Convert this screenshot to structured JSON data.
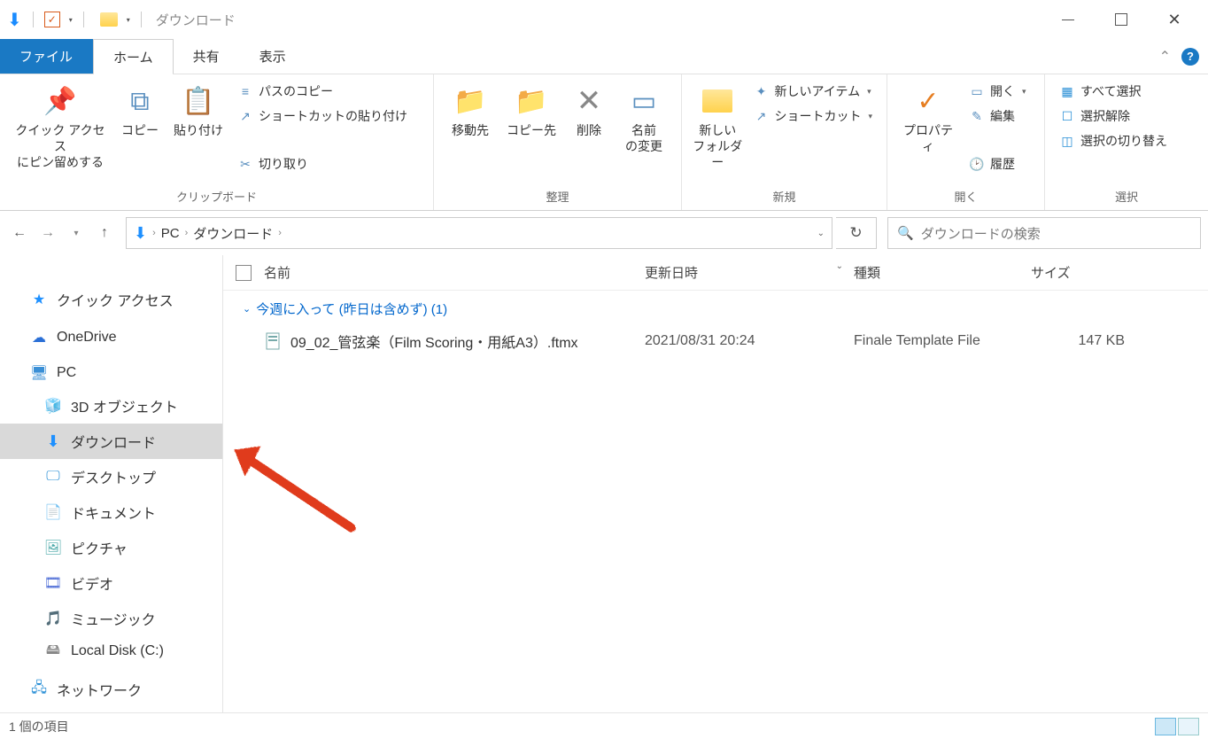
{
  "titlebar": {
    "title": "ダウンロード"
  },
  "tabs": {
    "file": "ファイル",
    "home": "ホーム",
    "share": "共有",
    "view": "表示"
  },
  "ribbon": {
    "pin": "クイック アクセス\nにピン留めする",
    "copy": "コピー",
    "paste": "貼り付け",
    "copy_path": "パスのコピー",
    "paste_shortcut": "ショートカットの貼り付け",
    "cut": "切り取り",
    "group_clipboard": "クリップボード",
    "move_to": "移動先",
    "copy_to": "コピー先",
    "delete": "削除",
    "rename": "名前\nの変更",
    "group_organize": "整理",
    "new_folder": "新しい\nフォルダー",
    "new_item": "新しいアイテム",
    "shortcut": "ショートカット",
    "group_new": "新規",
    "properties": "プロパティ",
    "open": "開く",
    "edit": "編集",
    "history": "履歴",
    "group_open": "開く",
    "select_all": "すべて選択",
    "select_none": "選択解除",
    "invert_sel": "選択の切り替え",
    "group_select": "選択"
  },
  "breadcrumb": {
    "pc": "PC",
    "downloads": "ダウンロード"
  },
  "search": {
    "placeholder": "ダウンロードの検索"
  },
  "columns": {
    "name": "名前",
    "date": "更新日時",
    "type": "種類",
    "size": "サイズ"
  },
  "nav": {
    "quick_access": "クイック アクセス",
    "onedrive": "OneDrive",
    "pc": "PC",
    "objects3d": "3D オブジェクト",
    "downloads": "ダウンロード",
    "desktop": "デスクトップ",
    "documents": "ドキュメント",
    "pictures": "ピクチャ",
    "videos": "ビデオ",
    "music": "ミュージック",
    "localdisk": "Local Disk (C:)",
    "network": "ネットワーク"
  },
  "group_label": "今週に入って (昨日は含めず) (1)",
  "file": {
    "name": "09_02_管弦楽（Film Scoring・用紙A3）.ftmx",
    "date": "2021/08/31 20:24",
    "type": "Finale Template File",
    "size": "147 KB"
  },
  "status": "1 個の項目"
}
